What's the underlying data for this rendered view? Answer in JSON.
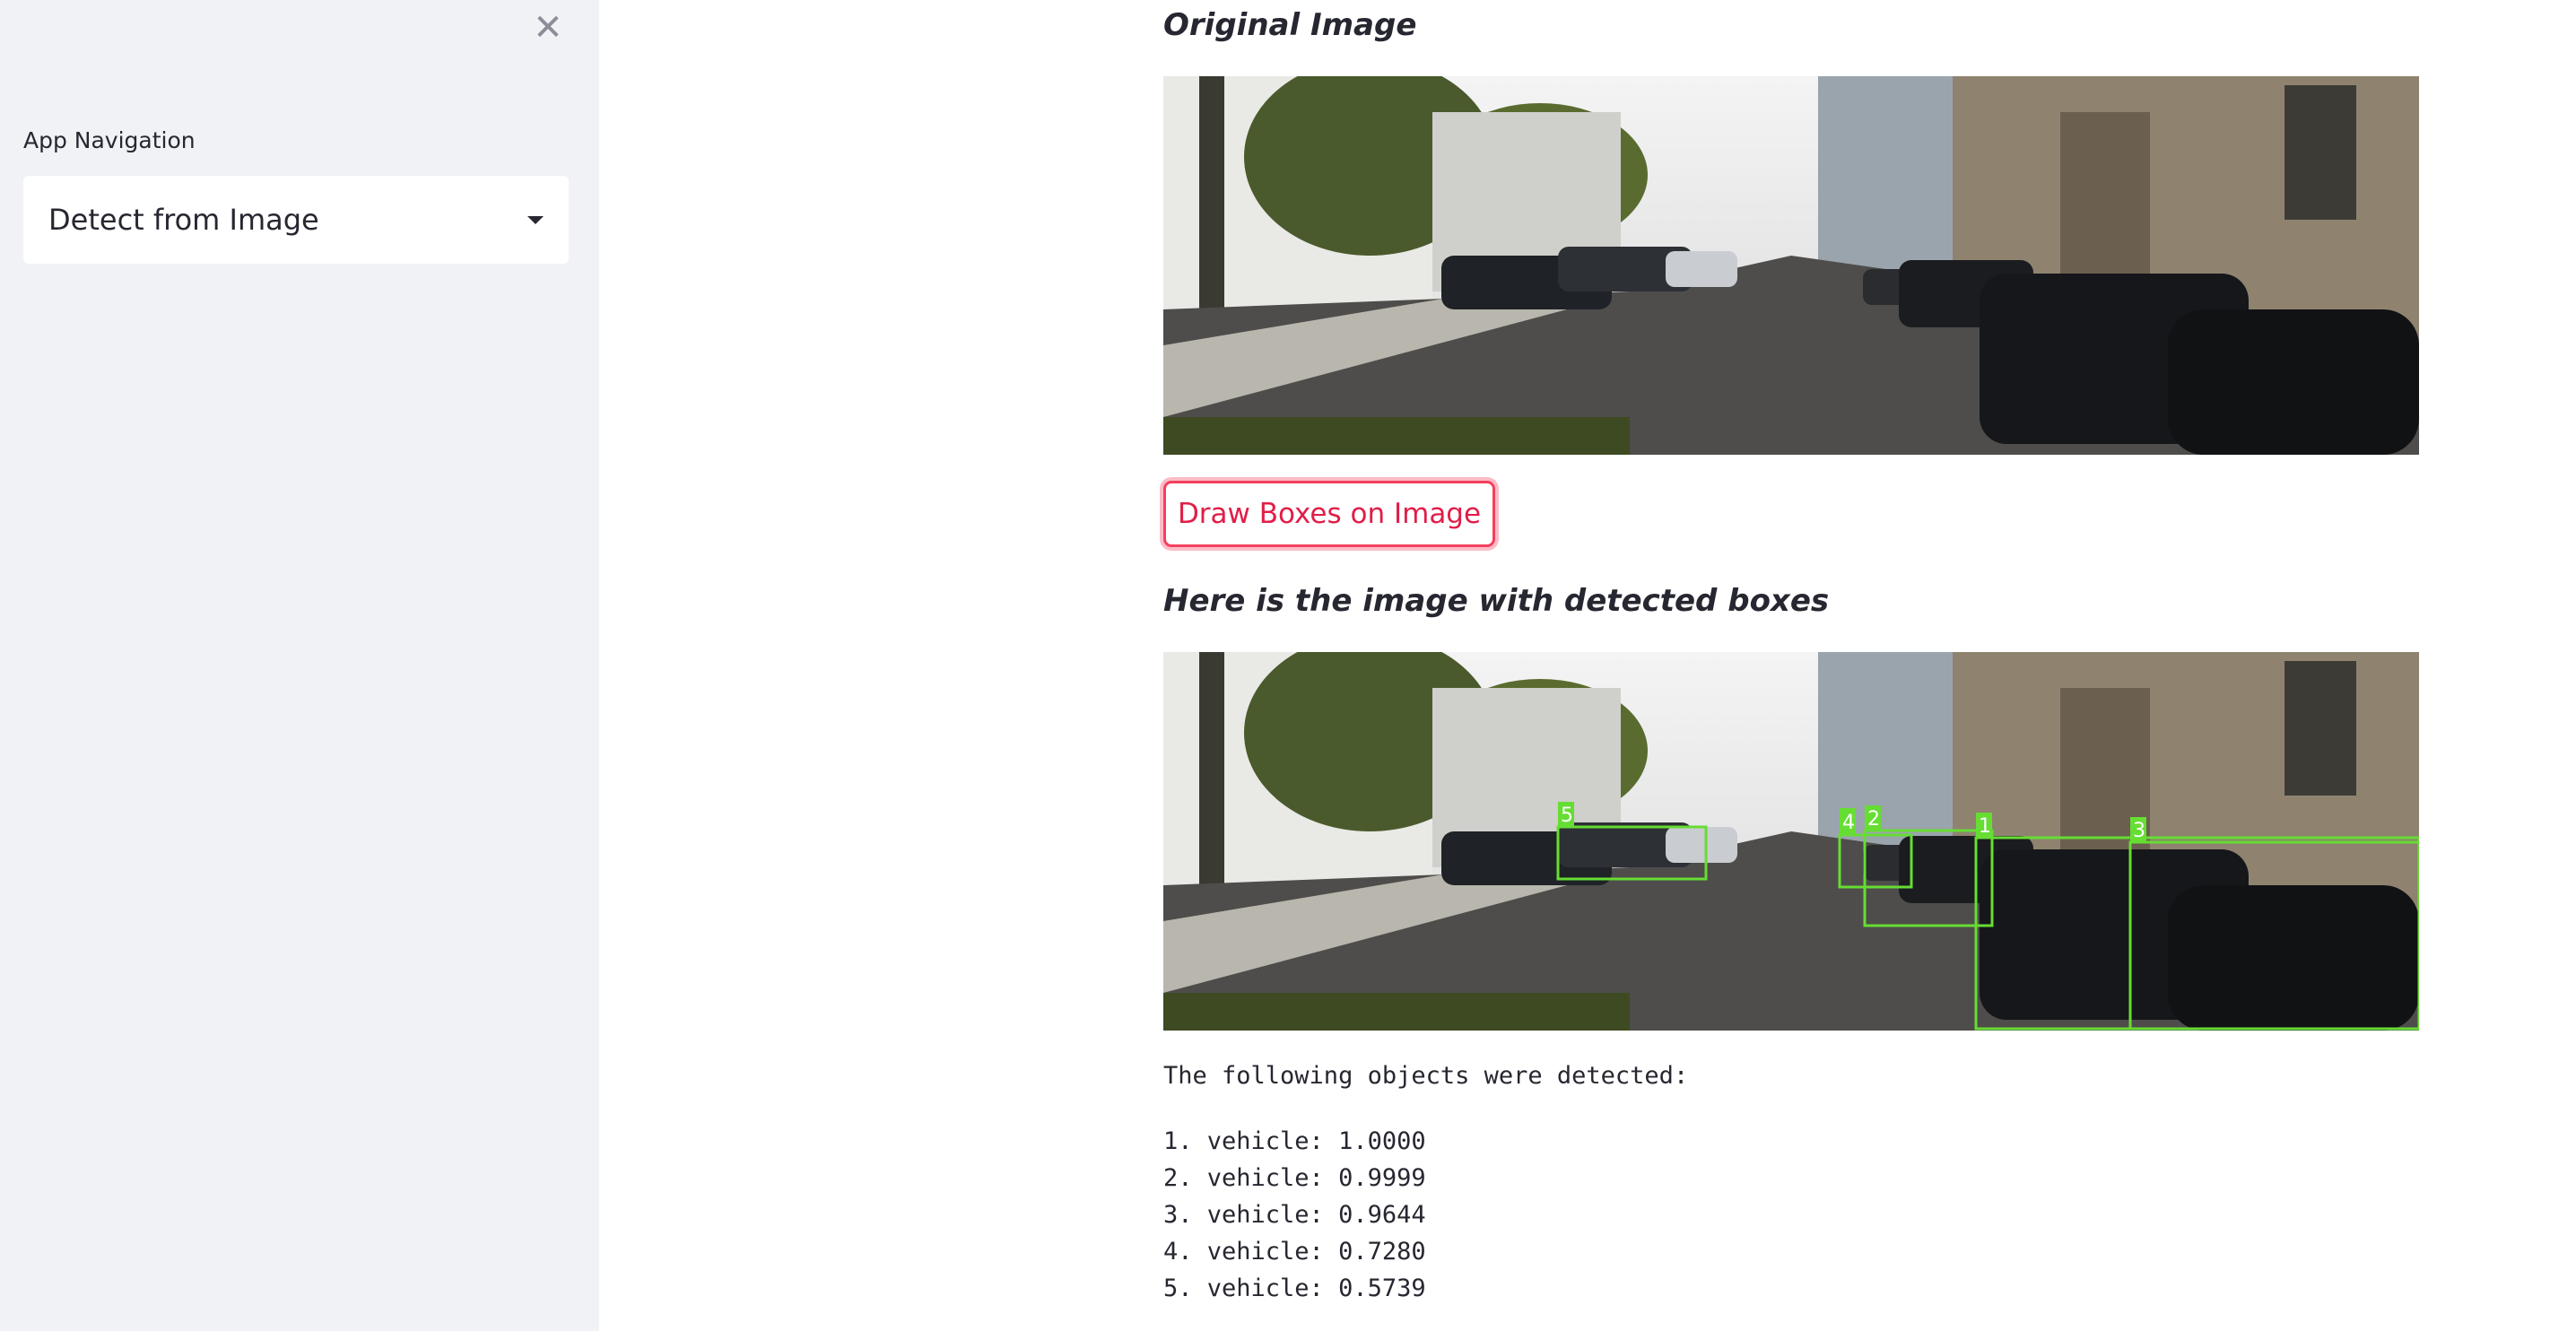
{
  "sidebar": {
    "close_icon": "close-icon",
    "nav_label": "App Navigation",
    "select_value": "Detect from Image",
    "caret_icon": "caret-down-icon"
  },
  "main": {
    "original_heading": "Original Image",
    "draw_button_label": "Draw Boxes on Image",
    "boxes_heading": "Here is the image with detected boxes",
    "detected_intro": "The following objects were detected:",
    "detections": [
      {
        "index": "1",
        "label": "vehicle",
        "score": "1.0000",
        "text": "1. vehicle: 1.0000"
      },
      {
        "index": "2",
        "label": "vehicle",
        "score": "0.9999",
        "text": "2. vehicle: 0.9999"
      },
      {
        "index": "3",
        "label": "vehicle",
        "score": "0.9644",
        "text": "3. vehicle: 0.9644"
      },
      {
        "index": "4",
        "label": "vehicle",
        "score": "0.7280",
        "text": "4. vehicle: 0.7280"
      },
      {
        "index": "5",
        "label": "vehicle",
        "score": "0.5739",
        "text": "5. vehicle: 0.5739"
      }
    ],
    "box_color": "#66dd33",
    "accent_color": "#e11d48"
  }
}
